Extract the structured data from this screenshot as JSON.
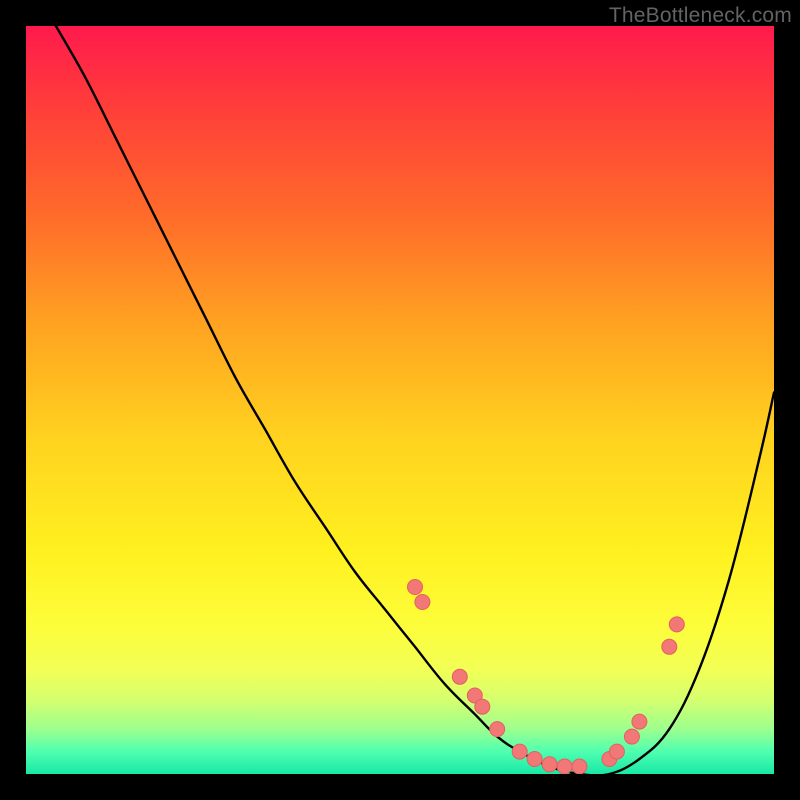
{
  "watermark": "TheBottleneck.com",
  "colors": {
    "frame": "#000000",
    "curve": "#000000",
    "dot_fill": "#f27777",
    "dot_stroke": "#e55f5f"
  },
  "chart_data": {
    "type": "line",
    "title": "",
    "xlabel": "",
    "ylabel": "",
    "xlim": [
      0,
      100
    ],
    "ylim": [
      0,
      100
    ],
    "series": [
      {
        "name": "bottleneck-curve",
        "x": [
          4,
          8,
          12,
          16,
          20,
          24,
          28,
          32,
          36,
          40,
          44,
          48,
          52,
          56,
          60,
          63,
          66,
          70,
          74,
          78,
          82,
          86,
          90,
          94,
          98,
          100
        ],
        "y": [
          100,
          93,
          85,
          77,
          69,
          61,
          53,
          46,
          39,
          33,
          27,
          22,
          17,
          12,
          8,
          5,
          3,
          1,
          0,
          0,
          2,
          6,
          14,
          26,
          42,
          51
        ]
      }
    ],
    "highlight_points": [
      {
        "x": 52,
        "y": 25
      },
      {
        "x": 53,
        "y": 23
      },
      {
        "x": 58,
        "y": 13
      },
      {
        "x": 60,
        "y": 10.5
      },
      {
        "x": 61,
        "y": 9
      },
      {
        "x": 63,
        "y": 6
      },
      {
        "x": 66,
        "y": 3
      },
      {
        "x": 68,
        "y": 2
      },
      {
        "x": 70,
        "y": 1.3
      },
      {
        "x": 72,
        "y": 1
      },
      {
        "x": 74,
        "y": 1
      },
      {
        "x": 78,
        "y": 2
      },
      {
        "x": 79,
        "y": 3
      },
      {
        "x": 81,
        "y": 5
      },
      {
        "x": 82,
        "y": 7
      },
      {
        "x": 86,
        "y": 17
      },
      {
        "x": 87,
        "y": 20
      }
    ]
  }
}
